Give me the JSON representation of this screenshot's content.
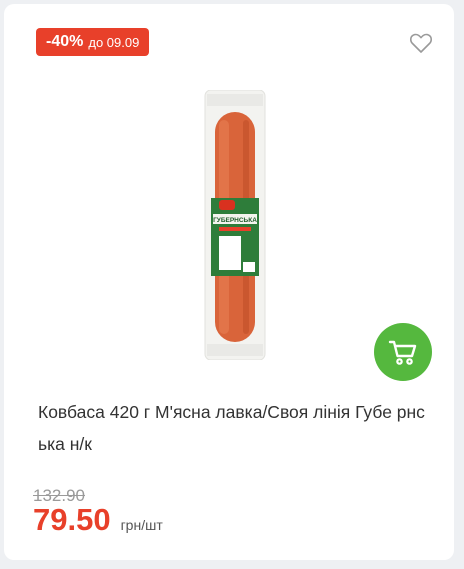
{
  "badge": {
    "discount": "-40%",
    "until": "до 09.09"
  },
  "icons": {
    "favorite": "heart-outline-icon",
    "cart": "cart-icon"
  },
  "product": {
    "title": "Ковбаса 420 г М'ясна лавка/Своя лінія Губе рнська н/к",
    "package_label": "ГУБЕРНСЬКА",
    "old_price": "132.90",
    "price": "79.50",
    "unit": "грн/шт"
  },
  "colors": {
    "discount": "#e8402a",
    "cart_button": "#55b83e",
    "brand_green": "#2e7d3a"
  }
}
